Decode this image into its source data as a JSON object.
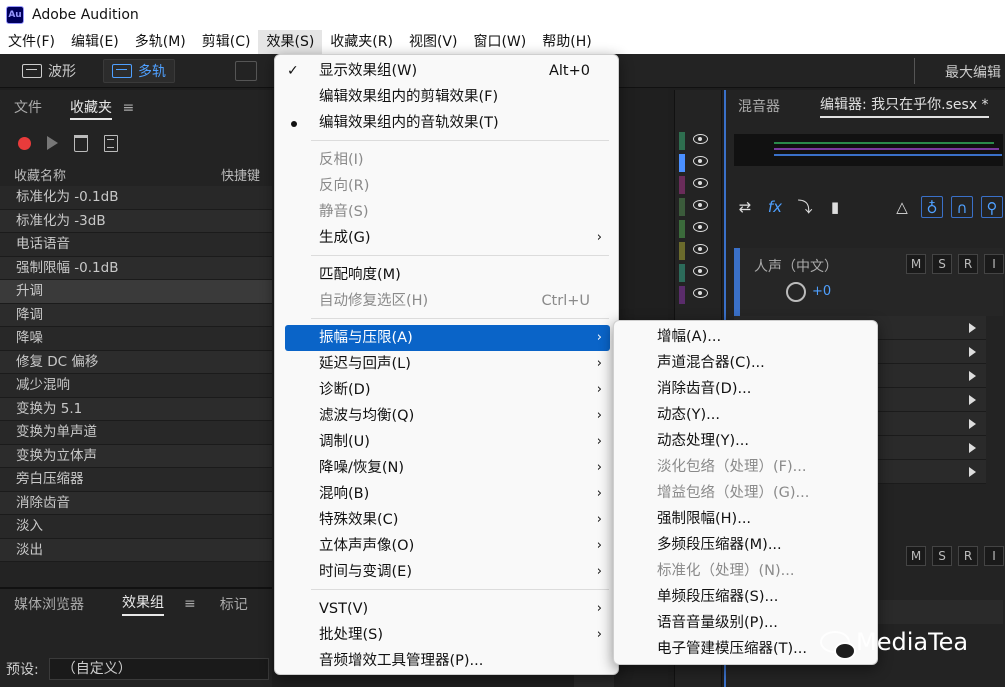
{
  "app": {
    "logo": "Au",
    "title": "Adobe Audition"
  },
  "menubar": [
    "文件(F)",
    "编辑(E)",
    "多轨(M)",
    "剪辑(C)",
    "效果(S)",
    "收藏夹(R)",
    "视图(V)",
    "窗口(W)",
    "帮助(H)"
  ],
  "toolbar": {
    "waveform": "波形",
    "multitrack": "多轨",
    "workspace": "最大编辑"
  },
  "left_panel": {
    "tabs": [
      "文件",
      "收藏夹"
    ],
    "col_name": "收藏名称",
    "col_shortcut": "快捷键",
    "favorites": [
      "标准化为 -0.1dB",
      "标准化为 -3dB",
      "电话语音",
      "强制限幅 -0.1dB",
      "升调",
      "降调",
      "降噪",
      "修复 DC 偏移",
      "减少混响",
      "变换为 5.1",
      "变换为单声道",
      "变换为立体声",
      "旁白压缩器",
      "消除齿音",
      "淡入",
      "淡出"
    ],
    "bottom_tabs": [
      "媒体浏览器",
      "效果组",
      "标记"
    ],
    "preset_label": "预设:",
    "preset_value": "（自定义）"
  },
  "right_panel": {
    "tabs": [
      "混音器",
      "编辑器: 我只在乎你.sesx *"
    ],
    "track_name": "人声（中文）",
    "volume": "+0",
    "msr": [
      "M",
      "S",
      "R",
      "I"
    ]
  },
  "effects_menu": {
    "show_effects_rack": "显示效果组(W)",
    "show_effects_rack_shortcut": "Alt+0",
    "edit_clip_effects": "编辑效果组内的剪辑效果(F)",
    "edit_track_effects": "编辑效果组内的音轨效果(T)",
    "invert": "反相(I)",
    "reverse": "反向(R)",
    "silence": "静音(S)",
    "generate": "生成(G)",
    "match_loudness": "匹配响度(M)",
    "auto_heal": "自动修复选区(H)",
    "auto_heal_shortcut": "Ctrl+U",
    "amplitude": "振幅与压限(A)",
    "delay": "延迟与回声(L)",
    "diagnostics": "诊断(D)",
    "filter_eq": "滤波与均衡(Q)",
    "modulation": "调制(U)",
    "noise_reduction": "降噪/恢复(N)",
    "reverb": "混响(B)",
    "special": "特殊效果(C)",
    "stereo_imagery": "立体声声像(O)",
    "time_pitch": "时间与变调(E)",
    "vst": "VST(V)",
    "batch": "批处理(S)",
    "plugin_manager": "音频增效工具管理器(P)..."
  },
  "amplitude_submenu": [
    {
      "label": "增幅(A)...",
      "enabled": true
    },
    {
      "label": "声道混合器(C)...",
      "enabled": true
    },
    {
      "label": "消除齿音(D)...",
      "enabled": true
    },
    {
      "label": "动态(Y)...",
      "enabled": true
    },
    {
      "label": "动态处理(Y)...",
      "enabled": true
    },
    {
      "label": "淡化包络（处理）(F)...",
      "enabled": false
    },
    {
      "label": "增益包络（处理）(G)...",
      "enabled": false
    },
    {
      "label": "强制限幅(H)...",
      "enabled": true
    },
    {
      "label": "多频段压缩器(M)...",
      "enabled": true
    },
    {
      "label": "标准化（处理）(N)...",
      "enabled": false
    },
    {
      "label": "单频段压缩器(S)...",
      "enabled": true
    },
    {
      "label": "语音音量级别(P)...",
      "enabled": true
    },
    {
      "label": "电子管建模压缩器(T)...",
      "enabled": true
    }
  ],
  "watermark": "MediaTea",
  "colors": {
    "accent": "#0a64c8",
    "record": "#e83b3b",
    "track_blue": "#3a70c8"
  }
}
